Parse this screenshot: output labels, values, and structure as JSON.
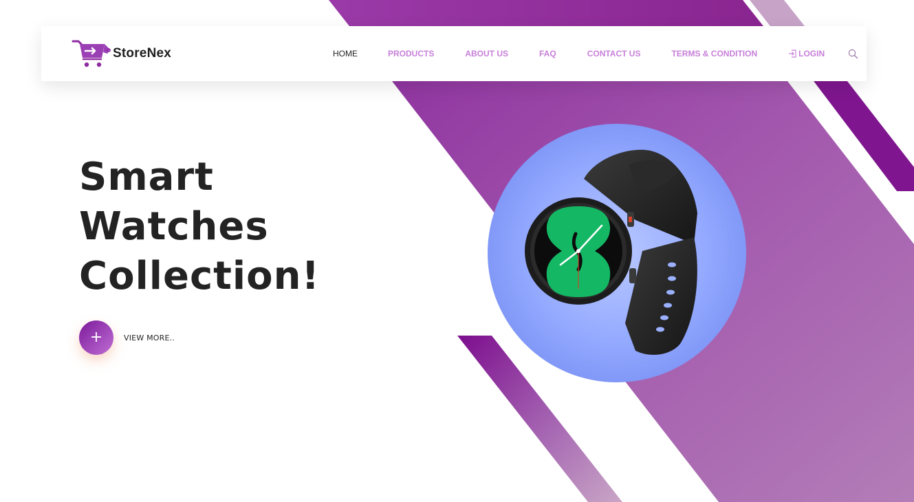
{
  "brand": {
    "name": "StoreNex",
    "logo_icon": "shopping-cart-icon",
    "color": "#9b3fb5"
  },
  "nav": {
    "items": [
      {
        "label": "HOME",
        "active": true
      },
      {
        "label": "PRODUCTS",
        "active": false
      },
      {
        "label": "ABOUT US",
        "active": false
      },
      {
        "label": "FAQ",
        "active": false
      },
      {
        "label": "CONTACT US",
        "active": false
      },
      {
        "label": "TERMS & CONDITION",
        "active": false
      }
    ],
    "login_label": "LOGIN",
    "login_icon": "login-icon",
    "search_icon": "search-icon"
  },
  "hero": {
    "title_lines": [
      "Smart",
      "Watches",
      "Collection!"
    ],
    "cta_symbol": "+",
    "cta_label": "VIEW MORE..",
    "product_image": "smartwatch-image"
  },
  "colors": {
    "accent": "#8e2a9f",
    "accent_light": "#c77fd9",
    "product_circle": "#8da4ff",
    "watch_face": "#14b864"
  }
}
